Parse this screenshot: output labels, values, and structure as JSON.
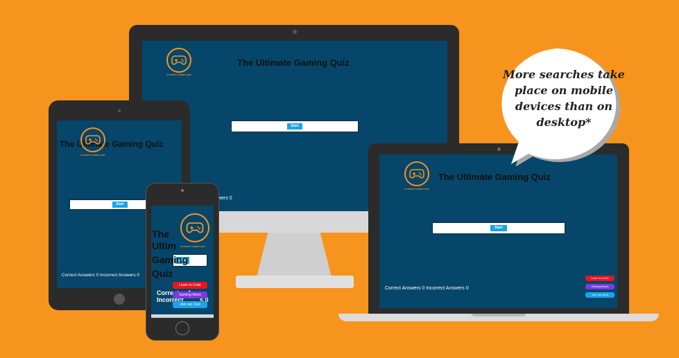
{
  "app_title": "The Ultimate Gaming Quiz",
  "logo_caption": "ULTIMATE GAMING QUIZ",
  "start_label": "Start",
  "score_text": "Correct Answers 0 Incorrect Answers 0",
  "score_partial": "Answers 0",
  "links": {
    "learn": "Learn to Code",
    "news": "Gaming News",
    "club": "Join our Club"
  },
  "bubble_text": "More searches take place on mobile devices than on desktop*",
  "phone": {
    "title_lines": [
      "The",
      "Ultim",
      "Gaming",
      "Quiz"
    ],
    "score_lines": [
      "Correct",
      "Incorrect"
    ],
    "score_frag_1": "A",
    "score_frag_2": "s 0"
  },
  "colors": {
    "background": "#f7941d",
    "screen": "#05466a",
    "accent": "#1aa3e8",
    "red": "#e8141f",
    "purple": "#7a3be0"
  }
}
